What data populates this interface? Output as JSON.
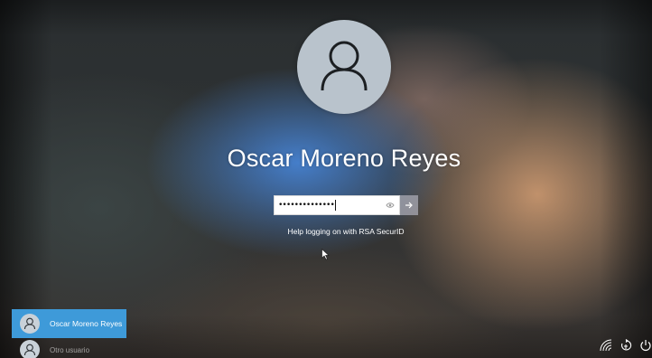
{
  "user": {
    "name": "Oscar Moreno Reyes"
  },
  "password": {
    "value": "••••••••••••••",
    "reveal_icon": "eye-icon",
    "submit_icon": "arrow-right-icon"
  },
  "help": {
    "label": "Help logging on with RSA SecurID"
  },
  "user_list": [
    {
      "name": "Oscar Moreno Reyes",
      "selected": true
    },
    {
      "name": "Otro usuario",
      "selected": false
    }
  ],
  "system_icons": [
    "network-icon",
    "accessibility-icon",
    "power-icon"
  ],
  "colors": {
    "selected_tile": "#3e9ad9",
    "avatar_bg": "#b9c3cc",
    "text": "#ffffff"
  }
}
